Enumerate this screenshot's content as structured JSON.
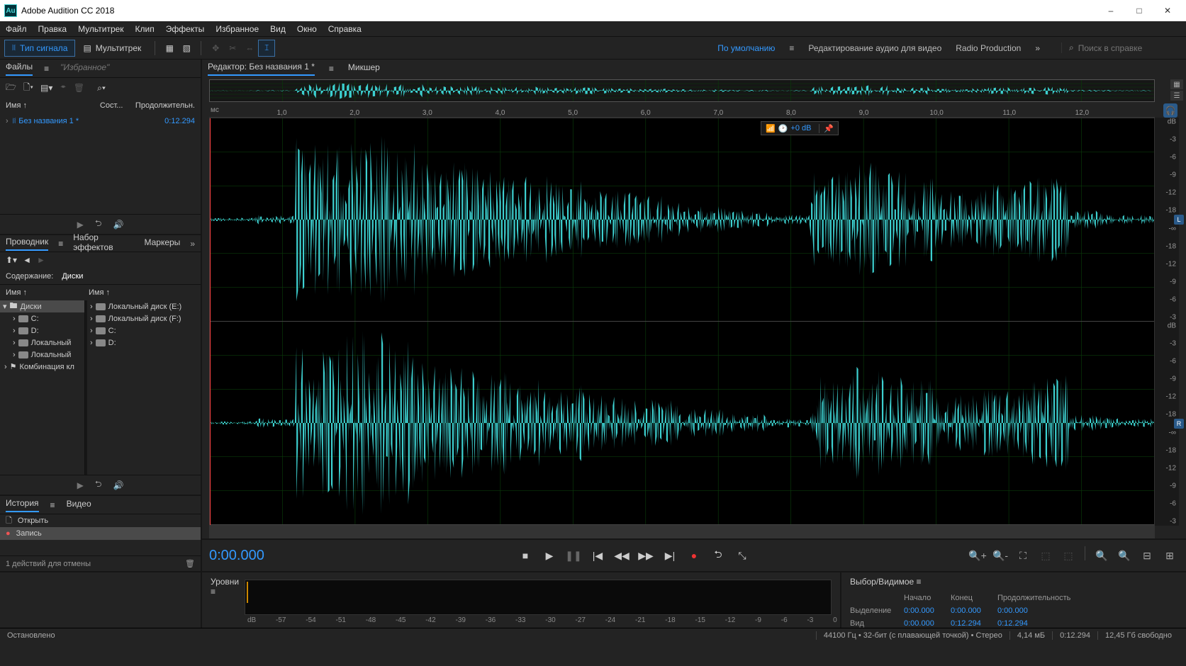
{
  "app": {
    "title": "Adobe Audition CC 2018"
  },
  "menu": [
    "Файл",
    "Правка",
    "Мультитрек",
    "Клип",
    "Эффекты",
    "Избранное",
    "Вид",
    "Окно",
    "Справка"
  ],
  "modes": {
    "waveform": "Тип сигнала",
    "multitrack": "Мультитрек"
  },
  "workspace": {
    "default": "По умолчанию",
    "edit_audio": "Редактирование аудио для видео",
    "radio": "Radio Production"
  },
  "search_placeholder": "Поиск в справке",
  "files_panel": {
    "tab1": "Файлы",
    "tab2": "\"Избранное\"",
    "col_name": "Имя ↑",
    "col_status": "Сост...",
    "col_duration": "Продолжительн.",
    "items": [
      {
        "name": "Без названия 1 *",
        "duration": "0:12.294"
      }
    ]
  },
  "browser": {
    "tab1": "Проводник",
    "tab2": "Набор эффектов",
    "tab3": "Маркеры",
    "content_label": "Содержание:",
    "content_value": "Диски",
    "col_name": "Имя ↑",
    "tree": [
      "Диски",
      "C:",
      "D:",
      "Локальный",
      "Локальный",
      "Комбинация кл"
    ],
    "list": [
      "Локальный диск (E:)",
      "Локальный диск (F:)",
      "C:",
      "D:"
    ]
  },
  "history": {
    "tab1": "История",
    "tab2": "Видео",
    "items": [
      {
        "icon": "open",
        "label": "Открыть"
      },
      {
        "icon": "rec",
        "label": "Запись",
        "sel": true
      }
    ],
    "undo_text": "1 действий для отмены"
  },
  "editor": {
    "tab_title": "Редактор: Без названия 1 *",
    "tab_mixer": "Микшер",
    "ruler_unit": "мс",
    "ruler_ticks": [
      "1,0",
      "2,0",
      "3,0",
      "4,0",
      "5,0",
      "6,0",
      "7,0",
      "8,0",
      "9,0",
      "10,0",
      "11,0",
      "12,0"
    ],
    "db_ticks": [
      "dB",
      "-3",
      "-6",
      "-9",
      "-12",
      "-18",
      "-∞",
      "-18",
      "-12",
      "-9",
      "-6",
      "-3"
    ],
    "channels": [
      "L",
      "R"
    ],
    "hud_db": "+0 dB",
    "timecode": "0:00.000"
  },
  "levels": {
    "label": "Уровни",
    "ticks": [
      "dB",
      "-57",
      "-54",
      "-51",
      "-48",
      "-45",
      "-42",
      "-39",
      "-36",
      "-33",
      "-30",
      "-27",
      "-24",
      "-21",
      "-18",
      "-15",
      "-12",
      "-9",
      "-6",
      "-3",
      "0"
    ]
  },
  "selection": {
    "title": "Выбор/Видимое",
    "h_start": "Начало",
    "h_end": "Конец",
    "h_dur": "Продолжительность",
    "r1": "Выделение",
    "r1v": [
      "0:00.000",
      "0:00.000",
      "0:00.000"
    ],
    "r2": "Вид",
    "r2v": [
      "0:00.000",
      "0:12.294",
      "0:12.294"
    ]
  },
  "status": {
    "stopped": "Остановлено",
    "format": "44100 Гц • 32-бит (с плавающей точкой) • Стерео",
    "size": "4,14 мБ",
    "dur": "0:12.294",
    "free": "12,45 Гб свободно"
  }
}
